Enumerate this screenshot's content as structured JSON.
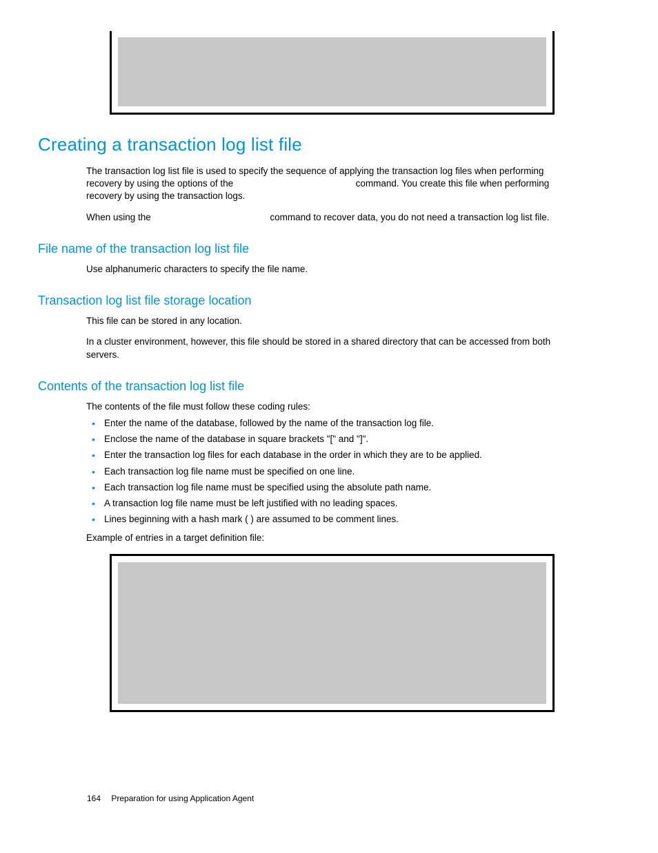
{
  "h1": "Creating a transaction log list file",
  "intro": {
    "p1a": "The transaction log list file is used to specify the sequence of applying the transaction log files when performing recovery by using the options of the ",
    "p1b": " command. You create this file when performing recovery by using the transaction logs.",
    "p2a": "When using the ",
    "p2b": " command to recover data, you do not need a transaction log list file."
  },
  "sec1": {
    "h": "File name of the transaction log list file",
    "p": "Use alphanumeric characters to specify the file name."
  },
  "sec2": {
    "h": "Transaction log list file storage location",
    "p1": "This file can be stored in any location.",
    "p2": "In a cluster environment, however, this file should be stored in a shared directory that can be accessed from both servers."
  },
  "sec3": {
    "h": "Contents of the transaction log list file",
    "lead": "The contents of the file must follow these coding rules:",
    "rules": [
      "Enter the name of the database, followed by the name of the transaction log file.",
      "Enclose the name of the database in square brackets \"[\" and \"]\".",
      "Enter the transaction log files for each database in the order in which they are to be applied.",
      "Each transaction log file name must be specified on one line.",
      "Each transaction log file name must be specified using the absolute path name.",
      "A transaction log file name must be left justified with no leading spaces.",
      "Lines beginning with a hash mark (  ) are assumed to be comment lines."
    ],
    "example_lead": "Example of entries in a target definition file:"
  },
  "footer": {
    "page": "164",
    "title": "Preparation for using Application Agent"
  }
}
